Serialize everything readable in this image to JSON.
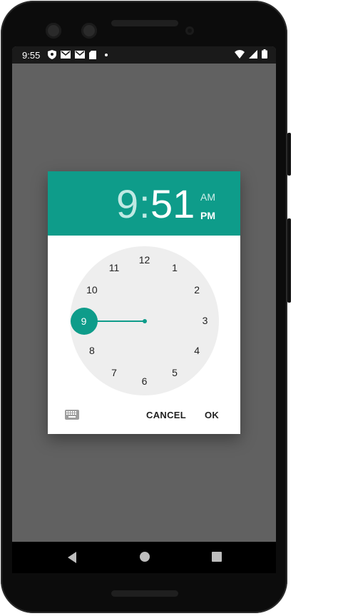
{
  "status_bar": {
    "time": "9:55",
    "left_icons": [
      "shield-icon",
      "gmail-icon",
      "gmail-icon",
      "sd-card-icon",
      "dot-icon"
    ],
    "right_icons": [
      "wifi-icon",
      "signal-icon",
      "battery-icon"
    ]
  },
  "dialog": {
    "hour": "9",
    "colon": ":",
    "minute": "51",
    "am_label": "AM",
    "pm_label": "PM",
    "selected_period": "PM",
    "clock_numbers": [
      "12",
      "1",
      "2",
      "3",
      "4",
      "5",
      "6",
      "7",
      "8",
      "9",
      "10",
      "11"
    ],
    "selected_number": "9",
    "buttons": {
      "cancel": "CANCEL",
      "ok": "OK"
    },
    "accent_color": "#0e9c8a"
  },
  "nav_bar": {
    "icons": [
      "back-icon",
      "home-icon",
      "recents-icon"
    ]
  }
}
